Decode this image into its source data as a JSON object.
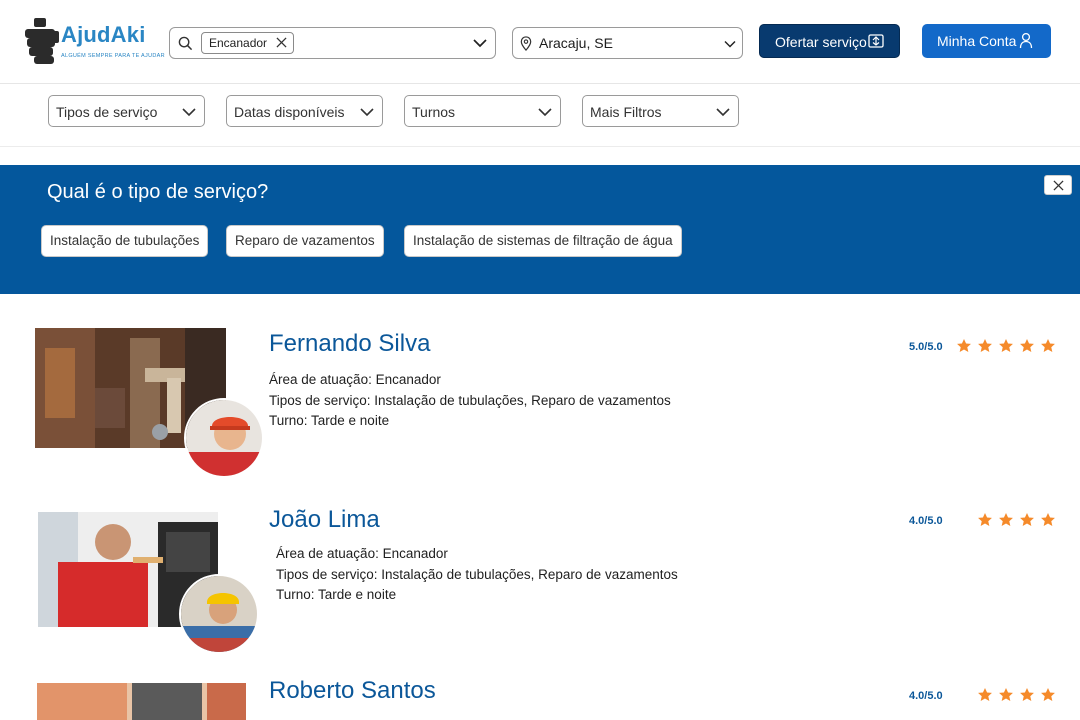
{
  "header": {
    "logo": {
      "name": "AjudAki",
      "tagline": "ALGUÉM SEMPRE PARA TE AJUDAR"
    },
    "search": {
      "chip": "Encanador"
    },
    "location": {
      "value": "Aracaju, SE"
    },
    "offer_button": "Ofertar serviço",
    "account_button": "Minha Conta"
  },
  "filters": [
    "Tipos de serviço",
    "Datas disponíveis",
    "Turnos",
    "Mais Filtros"
  ],
  "banner": {
    "title": "Qual é o tipo de serviço?",
    "options": [
      "Instalação de tubulações",
      "Reparo de vazamentos",
      "Instalação de sistemas de filtração de água"
    ]
  },
  "results": [
    {
      "name": "Fernando Silva",
      "area": "Área de atuação: Encanador",
      "services": "Tipos de serviço: Instalação de tubulações, Reparo de vazamentos",
      "shift": "Turno: Tarde e noite",
      "score": "5.0/5.0",
      "stars": 5
    },
    {
      "name": "João Lima",
      "area": "Área de atuação: Encanador",
      "services": "Tipos de serviço: Instalação de tubulações, Reparo de vazamentos",
      "shift": "Turno: Tarde e noite",
      "score": "4.0/5.0",
      "stars": 4
    },
    {
      "name": "Roberto Santos",
      "score": "4.0/5.0",
      "stars": 4
    }
  ],
  "colors": {
    "primary_dark": "#083a6f",
    "primary": "#1369c9",
    "banner": "#04579c",
    "star": "#f58a2a"
  },
  "icons": [
    "logo-hand-icon",
    "search-icon",
    "close-icon",
    "chevron-down-icon",
    "location-pin-icon",
    "offer-icon",
    "user-icon",
    "star-icon"
  ]
}
